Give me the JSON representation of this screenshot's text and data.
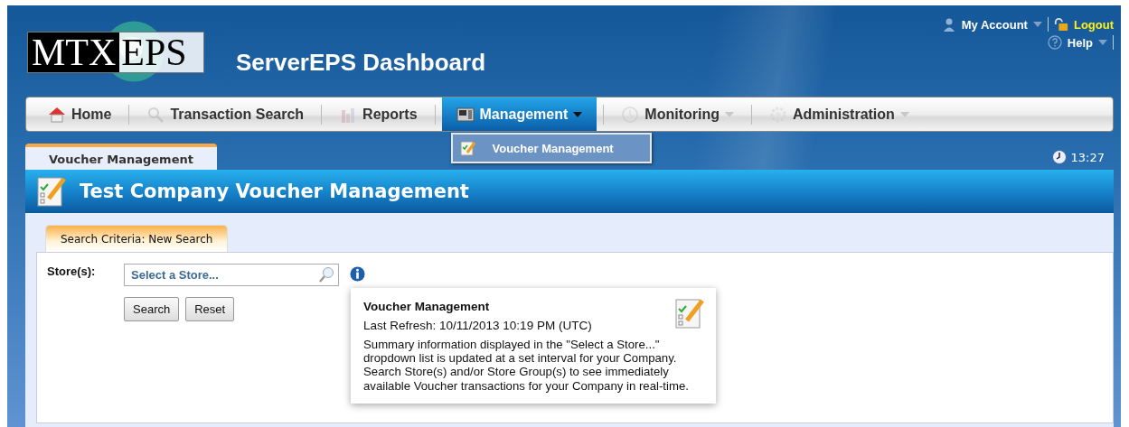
{
  "header": {
    "logo": {
      "left": "MTX",
      "right": "EPS"
    },
    "title": "ServerEPS Dashboard",
    "account": {
      "label": "My Account"
    },
    "logout": {
      "label": "Logout"
    },
    "help": {
      "label": "Help"
    }
  },
  "nav": [
    {
      "label": "Home",
      "selected": false,
      "has_menu": false
    },
    {
      "label": "Transaction Search",
      "selected": false,
      "has_menu": false
    },
    {
      "label": "Reports",
      "selected": false,
      "has_menu": false
    },
    {
      "label": "Management",
      "selected": true,
      "has_menu": true
    },
    {
      "label": "Monitoring",
      "selected": false,
      "has_menu": true
    },
    {
      "label": "Administration",
      "selected": false,
      "has_menu": true
    }
  ],
  "dropdown": {
    "items": [
      {
        "label": "Voucher Management"
      }
    ]
  },
  "page_tabs": [
    {
      "label": "Voucher Management",
      "selected": true
    }
  ],
  "clock": "13:27",
  "panel": {
    "title": "Test Company Voucher Management"
  },
  "sub_tabs": [
    {
      "label": "Search Criteria: New Search",
      "selected": true
    }
  ],
  "form": {
    "store_label": "Store(s):",
    "store_field": {
      "placeholder": "Select a Store..."
    },
    "buttons": [
      "Search",
      "Reset"
    ]
  },
  "tooltip": {
    "title": "Voucher Management",
    "refresh": "Last Refresh: 10/11/2013 10:19 PM (UTC)",
    "body": "Summary information displayed in the \"Select a Store...\" dropdown list is updated at a set interval for your Company. Search Store(s) and/or Store Group(s) to see immediately available Voucher transactions for your Company in real-time."
  }
}
